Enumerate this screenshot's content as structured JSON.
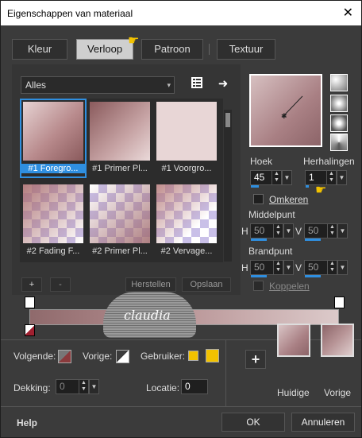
{
  "window": {
    "title": "Eigenschappen van materiaal",
    "close_glyph": "✕"
  },
  "tabs": [
    {
      "label": "Kleur"
    },
    {
      "label": "Verloop"
    },
    {
      "label": "Patroon"
    },
    {
      "label": "Textuur"
    }
  ],
  "gradient_category": {
    "value": "Alles",
    "arrow": "▾"
  },
  "gradients": [
    {
      "label": "#1 Foregro..."
    },
    {
      "label": "#1 Primer Pl..."
    },
    {
      "label": "#1 Voorgro..."
    },
    {
      "label": "#2 Fading F..."
    },
    {
      "label": "#2 Primer Pl..."
    },
    {
      "label": "#2 Vervage..."
    }
  ],
  "list_buttons": {
    "add": "+",
    "remove": "-",
    "restore": "Herstellen",
    "save": "Opslaan"
  },
  "angle": {
    "label": "Hoek",
    "value": "45"
  },
  "repeats": {
    "label": "Herhalingen",
    "value": "1"
  },
  "invert": {
    "label": "Omkeren"
  },
  "midpoint": {
    "label": "Middelpunt",
    "h_label": "H",
    "h_value": "50",
    "v_label": "V",
    "v_value": "50"
  },
  "focal_point": {
    "label": "Brandpunt",
    "h_label": "H",
    "h_value": "50",
    "v_label": "V",
    "v_value": "50"
  },
  "link": {
    "label": "Koppelen"
  },
  "watermark": {
    "text": "claudia"
  },
  "bottom": {
    "next_label": "Volgende:",
    "prev_label": "Vorige:",
    "user_label": "Gebruiker:",
    "opacity_label": "Dekking:",
    "opacity_value": "0",
    "location_label": "Locatie:",
    "location_value": "0",
    "add_glyph": "+",
    "current_label": "Huidige",
    "previous_label": "Vorige"
  },
  "footer": {
    "help": "Help",
    "ok": "OK",
    "cancel": "Annuleren"
  },
  "colors": {
    "accent": "#2f8fe0",
    "user_swatch": "#f2c200",
    "gradient_dark": "#8f6a6c",
    "gradient_light": "#dccaca"
  }
}
